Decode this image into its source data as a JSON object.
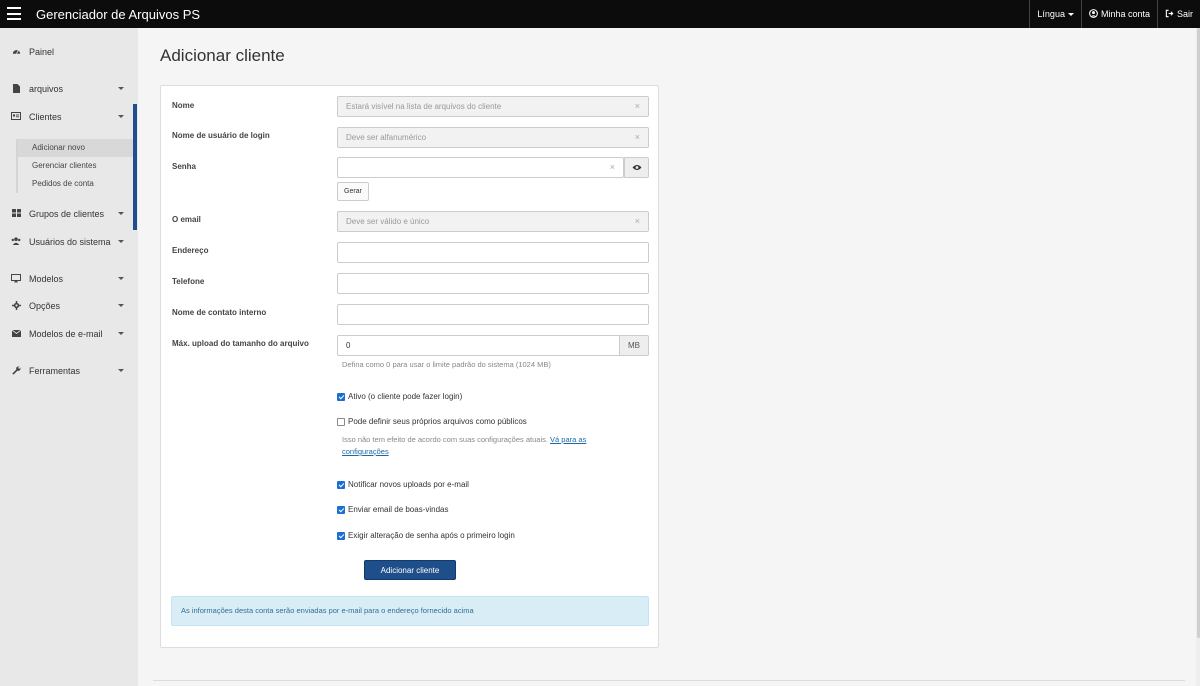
{
  "topbar": {
    "app_title": "Gerenciador de Arquivos PS",
    "language_label": "Língua",
    "account_label": "Minha conta",
    "logout_label": "Sair"
  },
  "sidebar": {
    "items": [
      {
        "label": "Painel",
        "icon": "dashboard-icon"
      },
      {
        "label": "arquivos",
        "icon": "file-icon"
      },
      {
        "label": "Clientes",
        "icon": "address-card-icon"
      },
      {
        "label": "Grupos de clientes",
        "icon": "th-large-icon"
      },
      {
        "label": "Usuários do sistema",
        "icon": "users-icon"
      },
      {
        "label": "Modelos",
        "icon": "desktop-icon"
      },
      {
        "label": "Opções",
        "icon": "gear-icon"
      },
      {
        "label": "Modelos de e-mail",
        "icon": "envelope-icon"
      },
      {
        "label": "Ferramentas",
        "icon": "wrench-icon"
      }
    ],
    "clientes_sub": [
      {
        "label": "Adicionar novo",
        "active": true
      },
      {
        "label": "Gerenciar clientes",
        "active": false
      },
      {
        "label": "Pedidos de conta",
        "active": false
      }
    ]
  },
  "page": {
    "title": "Adicionar cliente"
  },
  "form": {
    "name_label": "Nome",
    "name_placeholder": "Estará visível na lista de arquivos do cliente",
    "username_label": "Nome de usuário de login",
    "username_placeholder": "Deve ser alfanumérico",
    "password_label": "Senha",
    "password_value": "",
    "generate_label": "Gerar",
    "email_label": "O email",
    "email_placeholder": "Deve ser válido e único",
    "address_label": "Endereço",
    "phone_label": "Telefone",
    "contact_label": "Nome de contato interno",
    "max_upload_label": "Máx. upload do tamanho do arquivo",
    "max_upload_value": "0",
    "max_upload_unit": "MB",
    "max_upload_help": "Defina como 0 para usar o limite padrão do sistema (1024 MB)",
    "clear_symbol": "×",
    "checkboxes": {
      "active": {
        "label": "Ativo (o cliente pode fazer login)",
        "checked": true
      },
      "public": {
        "label": "Pode definir seus próprios arquivos como públicos",
        "checked": false
      },
      "notify": {
        "label": "Notificar novos uploads por e-mail",
        "checked": true
      },
      "welcome": {
        "label": "Enviar email de boas-vindas",
        "checked": true
      },
      "require_change": {
        "label": "Exigir alteração de senha após o primeiro login",
        "checked": true
      }
    },
    "public_help": "Isso não tem efeito de acordo com suas configurações atuais.",
    "public_help_link_1": "Vá para as",
    "public_help_link_2": "configurações",
    "submit_label": "Adicionar cliente",
    "info_text": "As informações desta conta serão enviadas por e-mail para o endereço fornecido acima"
  },
  "colors": {
    "topbar": "#0c0c0c",
    "sidebar": "#e8e8e8",
    "accent": "#1e4f8a",
    "checkbox": "#1b6fd0",
    "alert_bg": "#d9edf7"
  }
}
